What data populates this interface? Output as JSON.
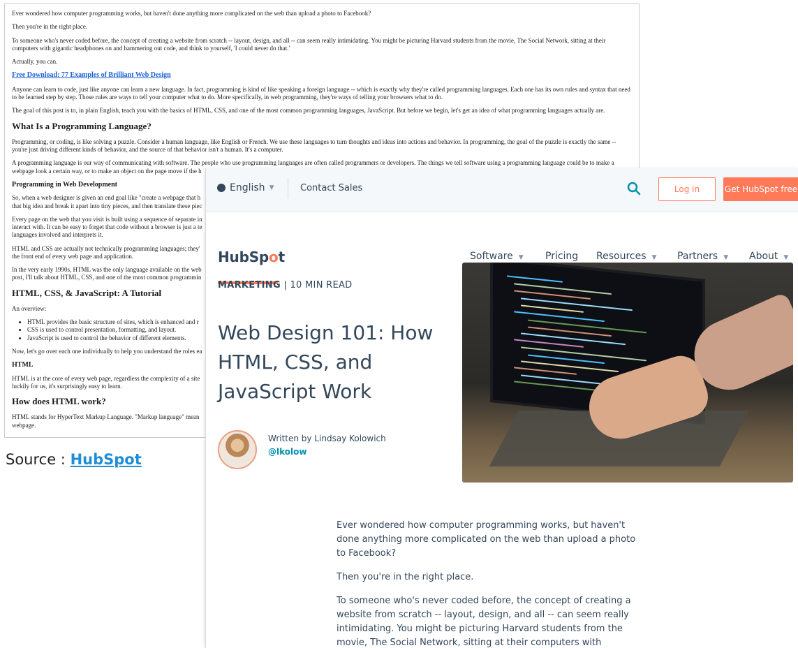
{
  "plain_page": {
    "p1": "Ever wondered how computer programming works, but haven't done anything more complicated on the web than upload a photo to Facebook?",
    "p2": "Then you're in the right place.",
    "p3": "To someone who's never coded before, the concept of creating a website from scratch -- layout, design, and all -- can seem really intimidating. You might be picturing Harvard students from the movie, The Social Network, sitting at their computers with gigantic headphones on and hammering out code, and think to yourself, 'I could never do that.'",
    "p4": "Actually, you can.",
    "download_link": "Free Download: 77 Examples of Brilliant Web Design",
    "p5": "Anyone can learn to code, just like anyone can learn a new language. In fact, programming is kind of like speaking a foreign language -- which is exactly why they're called programming languages. Each one has its own rules and syntax that need to be learned step by step. Those rules are ways to tell your computer what to do. More specifically, in web programming, they're ways of telling your browsers what to do.",
    "p6": "The goal of this post is to, in plain English, teach you with the basics of HTML, CSS, and one of the most common programming languages, JavaScript. But before we begin, let's get an idea of what programming languages actually are.",
    "h_what": "What Is a Programming Language?",
    "p7": "Programming, or coding, is like solving a puzzle. Consider a human language, like English or French. We use these languages to turn thoughts and ideas into actions and behavior. In programming, the goal of the puzzle is exactly the same -- you're just driving different kinds of behavior, and the source of that behavior isn't a human. It's a computer.",
    "p8": "A programming language is our way of communicating with software. The people who use programming languages are often called programmers or developers. The things we tell software using a programming language could be to make a webpage look a certain way, or to make an object on the page move if the h",
    "h_web": "Programming in Web Development",
    "p9": "So, when a web designer is given an end goal like \"create a webpage that h",
    "p9b": "that big idea and break it apart into tiny pieces, and then translate these piec",
    "p10": "Every page on the web that you visit is built using a sequence of separate in",
    "p10b": "interact with. It can be easy to forget that code without a browser is just a te",
    "p10c": "languages involved and interprets it.",
    "p11": "HTML and CSS are actually not technically programming languages; they'",
    "p11b": "the front end of every web page and application.",
    "p12": "In the very early 1990s, HTML was the only language available on the web",
    "p12b": "post, I'll talk about HTML, CSS, and one of the most common programmin",
    "h_tut": "HTML, CSS, & JavaScript: A Tutorial",
    "overview": "An overview:",
    "li1": "HTML provides the basic structure of sites, which is enhanced and r",
    "li2": "CSS is used to control presentation, formatting, and layout.",
    "li3": "JavaScript is used to control the behavior of different elements.",
    "p13": "Now, let's go over each one individually to help you understand the roles ea",
    "h_html": "HTML",
    "p14": "HTML is at the core of every web page, regardless the complexity of a site",
    "p14b": "luckily for us, it's surprisingly easy to learn.",
    "h_how": "How does HTML work?",
    "p15": "HTML stands for HyperText Markup Language. \"Markup language\" mean",
    "p15b": "webpage."
  },
  "source": {
    "prefix": "Source : ",
    "link": "HubSpot"
  },
  "hubspot": {
    "language": "English",
    "contact_sales": "Contact Sales",
    "login": "Log in",
    "get_free": "Get HubSpot free",
    "logo_left": "HubSp",
    "logo_mid": "o",
    "logo_right": "t",
    "nav": [
      "Software",
      "Pricing",
      "Resources",
      "Partners",
      "About"
    ],
    "category": "MARKETING",
    "read_time": " | 10 MIN READ",
    "title": "Web Design 101: How HTML, CSS, and JavaScript Work",
    "author": "Written by Lindsay Kolowich",
    "handle": "@lkolow",
    "body": [
      "Ever wondered how computer programming works, but haven't done anything more complicated on the web than upload a photo to Facebook?",
      "Then you're in the right place.",
      "To someone who's never coded before, the concept of creating a website from scratch -- layout, design, and all -- can seem really intimidating. You might be picturing Harvard students from the movie, The Social Network, sitting at their computers with gigantic headphones on and hammering out code, and think"
    ],
    "accent_color": "#ff7a59",
    "link_color": "#0091ae"
  }
}
